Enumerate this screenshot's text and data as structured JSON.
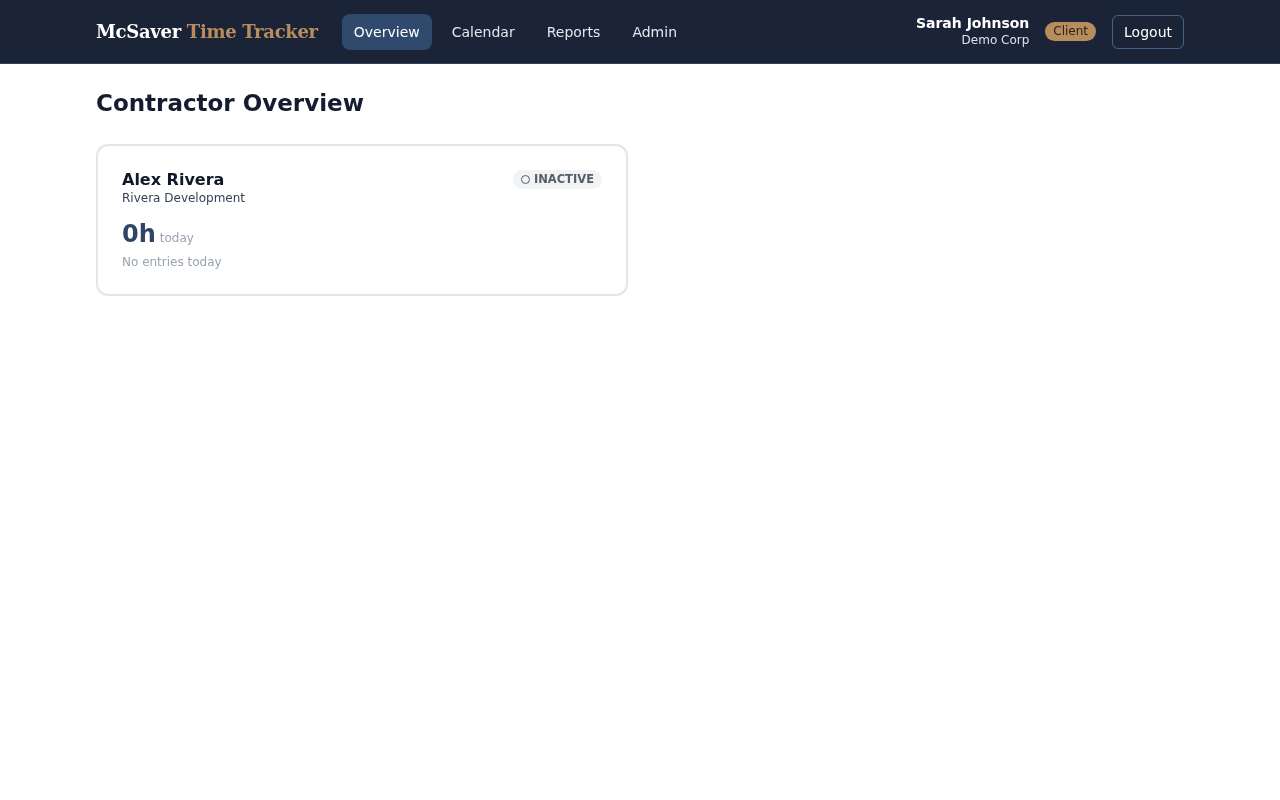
{
  "navbar": {
    "brand": {
      "name": "McSaver",
      "product": "Time Tracker"
    },
    "nav_items": [
      {
        "label": "Overview",
        "selected": true
      },
      {
        "label": "Calendar",
        "selected": false
      },
      {
        "label": "Reports",
        "selected": false
      },
      {
        "label": "Admin",
        "selected": false
      }
    ],
    "user": {
      "name": "Sarah Johnson",
      "company": "Demo Corp",
      "role_badge": "Client"
    },
    "logout_button": "Logout"
  },
  "page_title": "Contractor Overview",
  "contractors": [
    {
      "name": "Alex Rivera",
      "company": "Rivera Development",
      "status": {
        "label": "INACTIVE",
        "active": false
      },
      "hours": "0h",
      "hours_caption": "today",
      "note": "No entries today"
    }
  ]
}
